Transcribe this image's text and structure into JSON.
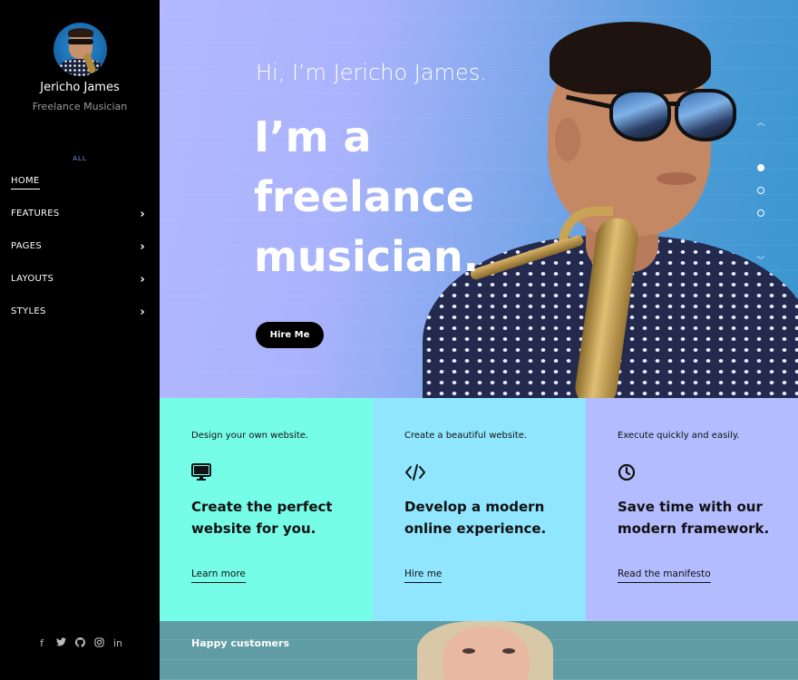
{
  "sidebar": {
    "name": "Jericho James",
    "role": "Freelance Musician",
    "filter_label": "ALL",
    "nav": [
      {
        "label": "HOME",
        "active": true,
        "has_submenu": false
      },
      {
        "label": "FEATURES",
        "active": false,
        "has_submenu": true
      },
      {
        "label": "PAGES",
        "active": false,
        "has_submenu": true
      },
      {
        "label": "LAYOUTS",
        "active": false,
        "has_submenu": true
      },
      {
        "label": "STYLES",
        "active": false,
        "has_submenu": true
      }
    ],
    "socials": [
      "facebook-icon",
      "twitter-icon",
      "github-icon",
      "instagram-icon",
      "linkedin-icon"
    ]
  },
  "hero": {
    "greeting": "Hi, I’m Jericho James.",
    "headline": "I’m a freelance musician.",
    "cta": "Hire Me",
    "slides": {
      "count": 3,
      "active_index": 0
    }
  },
  "features": [
    {
      "tag": "Design your own website.",
      "icon": "monitor-icon",
      "title": "Create the perfect website for you.",
      "link": "Learn more",
      "color": "#76fde8"
    },
    {
      "tag": "Create a beautiful website.",
      "icon": "code-icon",
      "title": "Develop a modern online experience.",
      "link": "Hire me",
      "color": "#8fe6fe"
    },
    {
      "tag": "Execute quickly and easily.",
      "icon": "clock-icon",
      "title": "Save time with our modern framework.",
      "link": "Read the manifesto",
      "color": "#b3bcfe"
    }
  ],
  "customers": {
    "label": "Happy customers"
  },
  "colors": {
    "sidebar_bg": "#000000",
    "hero_start": "#b3b8ff",
    "hero_end": "#3a96cf"
  }
}
